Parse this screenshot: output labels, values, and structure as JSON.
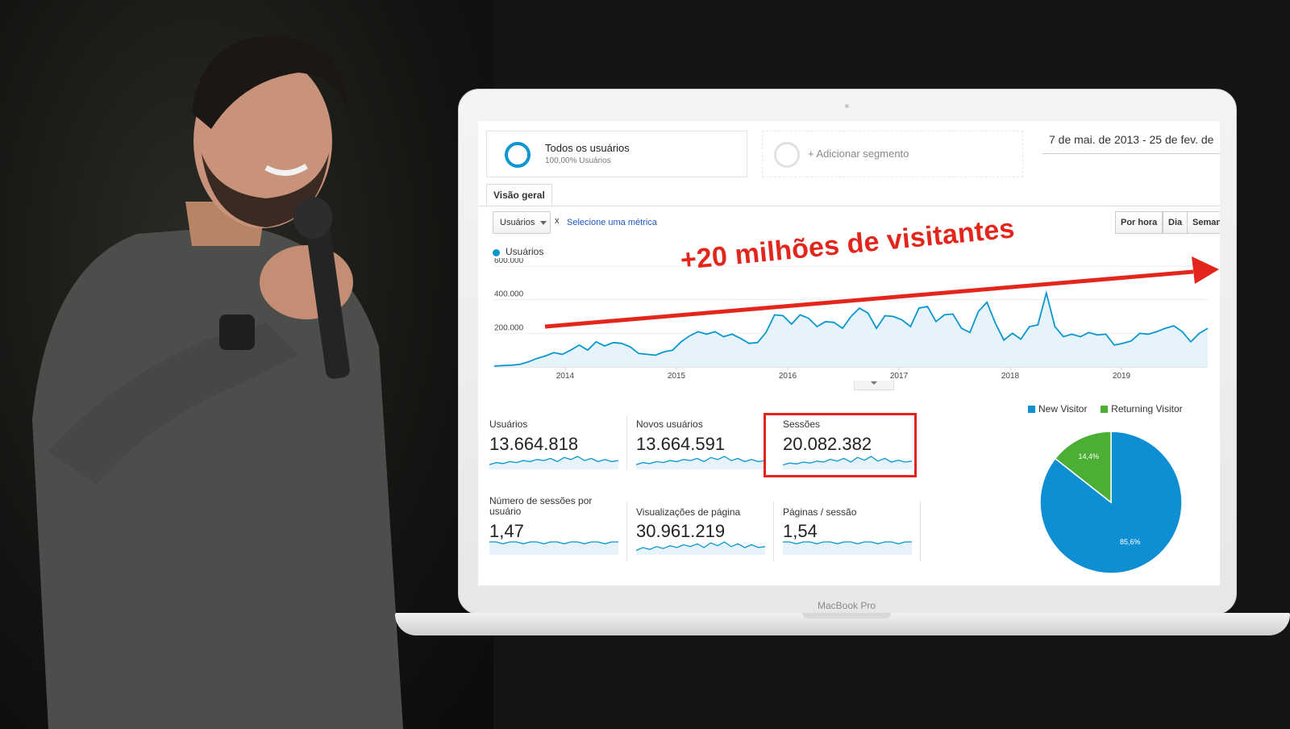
{
  "segments": {
    "primary": {
      "name": "Todos os usuários",
      "percentage": "100,00% Usuários"
    },
    "add_label": "+ Adicionar segmento"
  },
  "date_range": "7 de mai. de 2013 - 25 de fev. de",
  "tabs": [
    {
      "label": "Visão geral",
      "active": true
    }
  ],
  "metric_selector": {
    "value": "Usuários",
    "close": "x",
    "select_link": "Selecione uma métrica"
  },
  "time_buttons": {
    "hour": "Por hora",
    "day": "Dia",
    "week": "Semana"
  },
  "chart_data": [
    {
      "type": "area",
      "series": [
        {
          "name": "Usuários",
          "color": "#0a97d0",
          "values": [
            5000,
            8000,
            10000,
            15000,
            30000,
            50000,
            65000,
            85000,
            75000,
            100000,
            130000,
            100000,
            150000,
            125000,
            145000,
            140000,
            120000,
            80000,
            75000,
            70000,
            90000,
            100000,
            150000,
            185000,
            210000,
            195000,
            210000,
            180000,
            195000,
            170000,
            140000,
            145000,
            205000,
            310000,
            305000,
            255000,
            310000,
            290000,
            240000,
            270000,
            265000,
            230000,
            300000,
            350000,
            320000,
            230000,
            305000,
            300000,
            280000,
            240000,
            350000,
            360000,
            270000,
            310000,
            315000,
            230000,
            205000,
            330000,
            385000,
            260000,
            160000,
            200000,
            165000,
            240000,
            250000,
            440000,
            240000,
            180000,
            195000,
            180000,
            205000,
            190000,
            195000,
            130000,
            140000,
            155000,
            200000,
            195000,
            210000,
            230000,
            245000,
            210000,
            150000,
            200000,
            230000
          ]
        }
      ],
      "x_tick_labels": [
        "2014",
        "2015",
        "2016",
        "2017",
        "2018",
        "2019"
      ],
      "y_tick_labels": [
        "600.000",
        "400.000",
        "200.000"
      ],
      "ylim": [
        0,
        600000
      ],
      "grid": true,
      "legend": "top-left"
    },
    {
      "type": "pie",
      "legend": "top",
      "slices": [
        {
          "name": "New Visitor",
          "value": 85.6,
          "label": "85,6%",
          "color": "#0f8fd3"
        },
        {
          "name": "Returning Visitor",
          "value": 14.4,
          "label": "14,4%",
          "color": "#4caf35"
        }
      ]
    }
  ],
  "kpis": [
    {
      "label": "Usuários",
      "value": "13.664.818",
      "trend": [
        3,
        5,
        4,
        6,
        5,
        7,
        6,
        8,
        7,
        9,
        6,
        10,
        8,
        11,
        7,
        9,
        6,
        8,
        6,
        7
      ]
    },
    {
      "label": "Novos usuários",
      "value": "13.664.591",
      "trend": [
        3,
        5,
        4,
        6,
        5,
        7,
        6,
        8,
        7,
        9,
        6,
        10,
        8,
        11,
        7,
        9,
        6,
        8,
        6,
        7
      ]
    },
    {
      "label": "Sessões",
      "value": "20.082.382",
      "trend": [
        3,
        5,
        4,
        6,
        5,
        7,
        6,
        9,
        7,
        10,
        6,
        11,
        8,
        12,
        7,
        10,
        6,
        8,
        6,
        7
      ]
    },
    {
      "label": "Número de sessões por usuário",
      "value": "1,47",
      "trend": [
        6,
        6,
        5,
        6,
        6,
        5,
        6,
        6,
        5,
        6,
        6,
        5,
        6,
        6,
        5,
        6,
        6,
        5,
        6,
        6
      ]
    },
    {
      "label": "Visualizações de página",
      "value": "30.961.219",
      "trend": [
        3,
        6,
        4,
        7,
        5,
        8,
        6,
        9,
        7,
        10,
        6,
        11,
        8,
        12,
        7,
        10,
        6,
        9,
        6,
        7
      ]
    },
    {
      "label": "Páginas / sessão",
      "value": "1,54",
      "trend": [
        6,
        6,
        5,
        6,
        6,
        5,
        6,
        6,
        5,
        6,
        6,
        5,
        6,
        6,
        5,
        6,
        6,
        5,
        6,
        6
      ]
    }
  ],
  "laptop_brand": "MacBook Pro",
  "annotation": {
    "text": "+20 milhões de visitantes",
    "color": "#e3261b"
  },
  "colors": {
    "accent": "#0a97d0",
    "highlight": "#e0261c"
  }
}
